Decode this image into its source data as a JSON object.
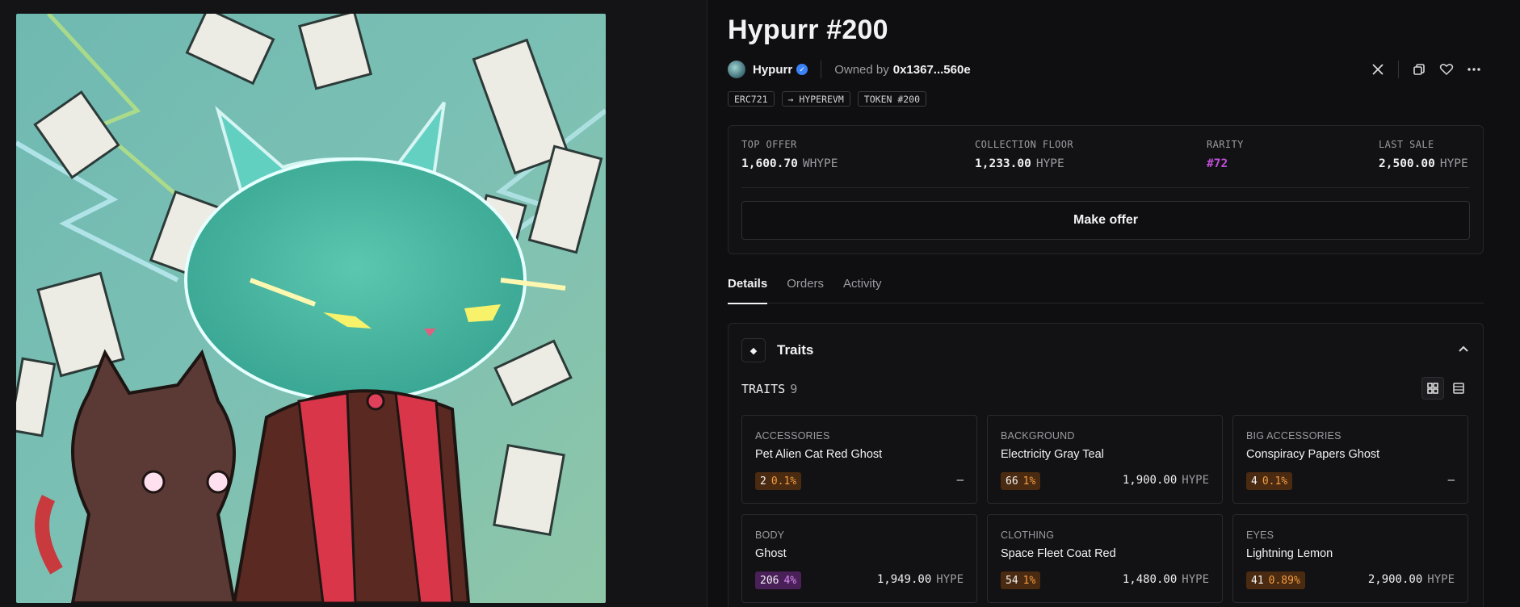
{
  "nft": {
    "title": "Hypurr #200",
    "collection": "Hypurr",
    "owned_by_label": "Owned by",
    "owner": "0x1367...560e"
  },
  "tags": [
    "ERC721",
    "→ HYPEREVM",
    "TOKEN #200"
  ],
  "stats": {
    "top_offer": {
      "label": "TOP OFFER",
      "value": "1,600.70",
      "unit": "WHYPE"
    },
    "floor": {
      "label": "COLLECTION FLOOR",
      "value": "1,233.00",
      "unit": "HYPE"
    },
    "rarity": {
      "label": "RARITY",
      "value": "#72"
    },
    "last_sale": {
      "label": "LAST SALE",
      "value": "2,500.00",
      "unit": "HYPE"
    }
  },
  "make_offer_label": "Make offer",
  "tabs": [
    {
      "label": "Details",
      "active": true
    },
    {
      "label": "Orders",
      "active": false
    },
    {
      "label": "Activity",
      "active": false
    }
  ],
  "traits": {
    "title": "Traits",
    "count_label": "TRAITS",
    "count": "9",
    "items": [
      {
        "category": "ACCESSORIES",
        "value": "Pet Alien Cat Red Ghost",
        "count": "2",
        "pct": "0.1%",
        "price": "–",
        "unit": "",
        "badge": "orange"
      },
      {
        "category": "BACKGROUND",
        "value": "Electricity Gray Teal",
        "count": "66",
        "pct": "1%",
        "price": "1,900.00",
        "unit": "HYPE",
        "badge": "orange"
      },
      {
        "category": "BIG ACCESSORIES",
        "value": "Conspiracy Papers Ghost",
        "count": "4",
        "pct": "0.1%",
        "price": "–",
        "unit": "",
        "badge": "orange"
      },
      {
        "category": "BODY",
        "value": "Ghost",
        "count": "206",
        "pct": "4%",
        "price": "1,949.00",
        "unit": "HYPE",
        "badge": "purple"
      },
      {
        "category": "CLOTHING",
        "value": "Space Fleet Coat Red",
        "count": "54",
        "pct": "1%",
        "price": "1,480.00",
        "unit": "HYPE",
        "badge": "orange"
      },
      {
        "category": "EYES",
        "value": "Lightning Lemon",
        "count": "41",
        "pct": "0.89%",
        "price": "2,900.00",
        "unit": "HYPE",
        "badge": "orange"
      }
    ]
  },
  "colors": {
    "rarity": "#c04fd9",
    "badge_orange": "#f59e42",
    "badge_purple": "#d88cf0",
    "verified": "#3b82f6"
  },
  "icons": [
    "x-logo-icon",
    "copy-icon",
    "heart-icon",
    "more-icon",
    "diamond-icon",
    "chevron-up-icon",
    "grid-view-icon",
    "list-view-icon",
    "verified-icon"
  ]
}
